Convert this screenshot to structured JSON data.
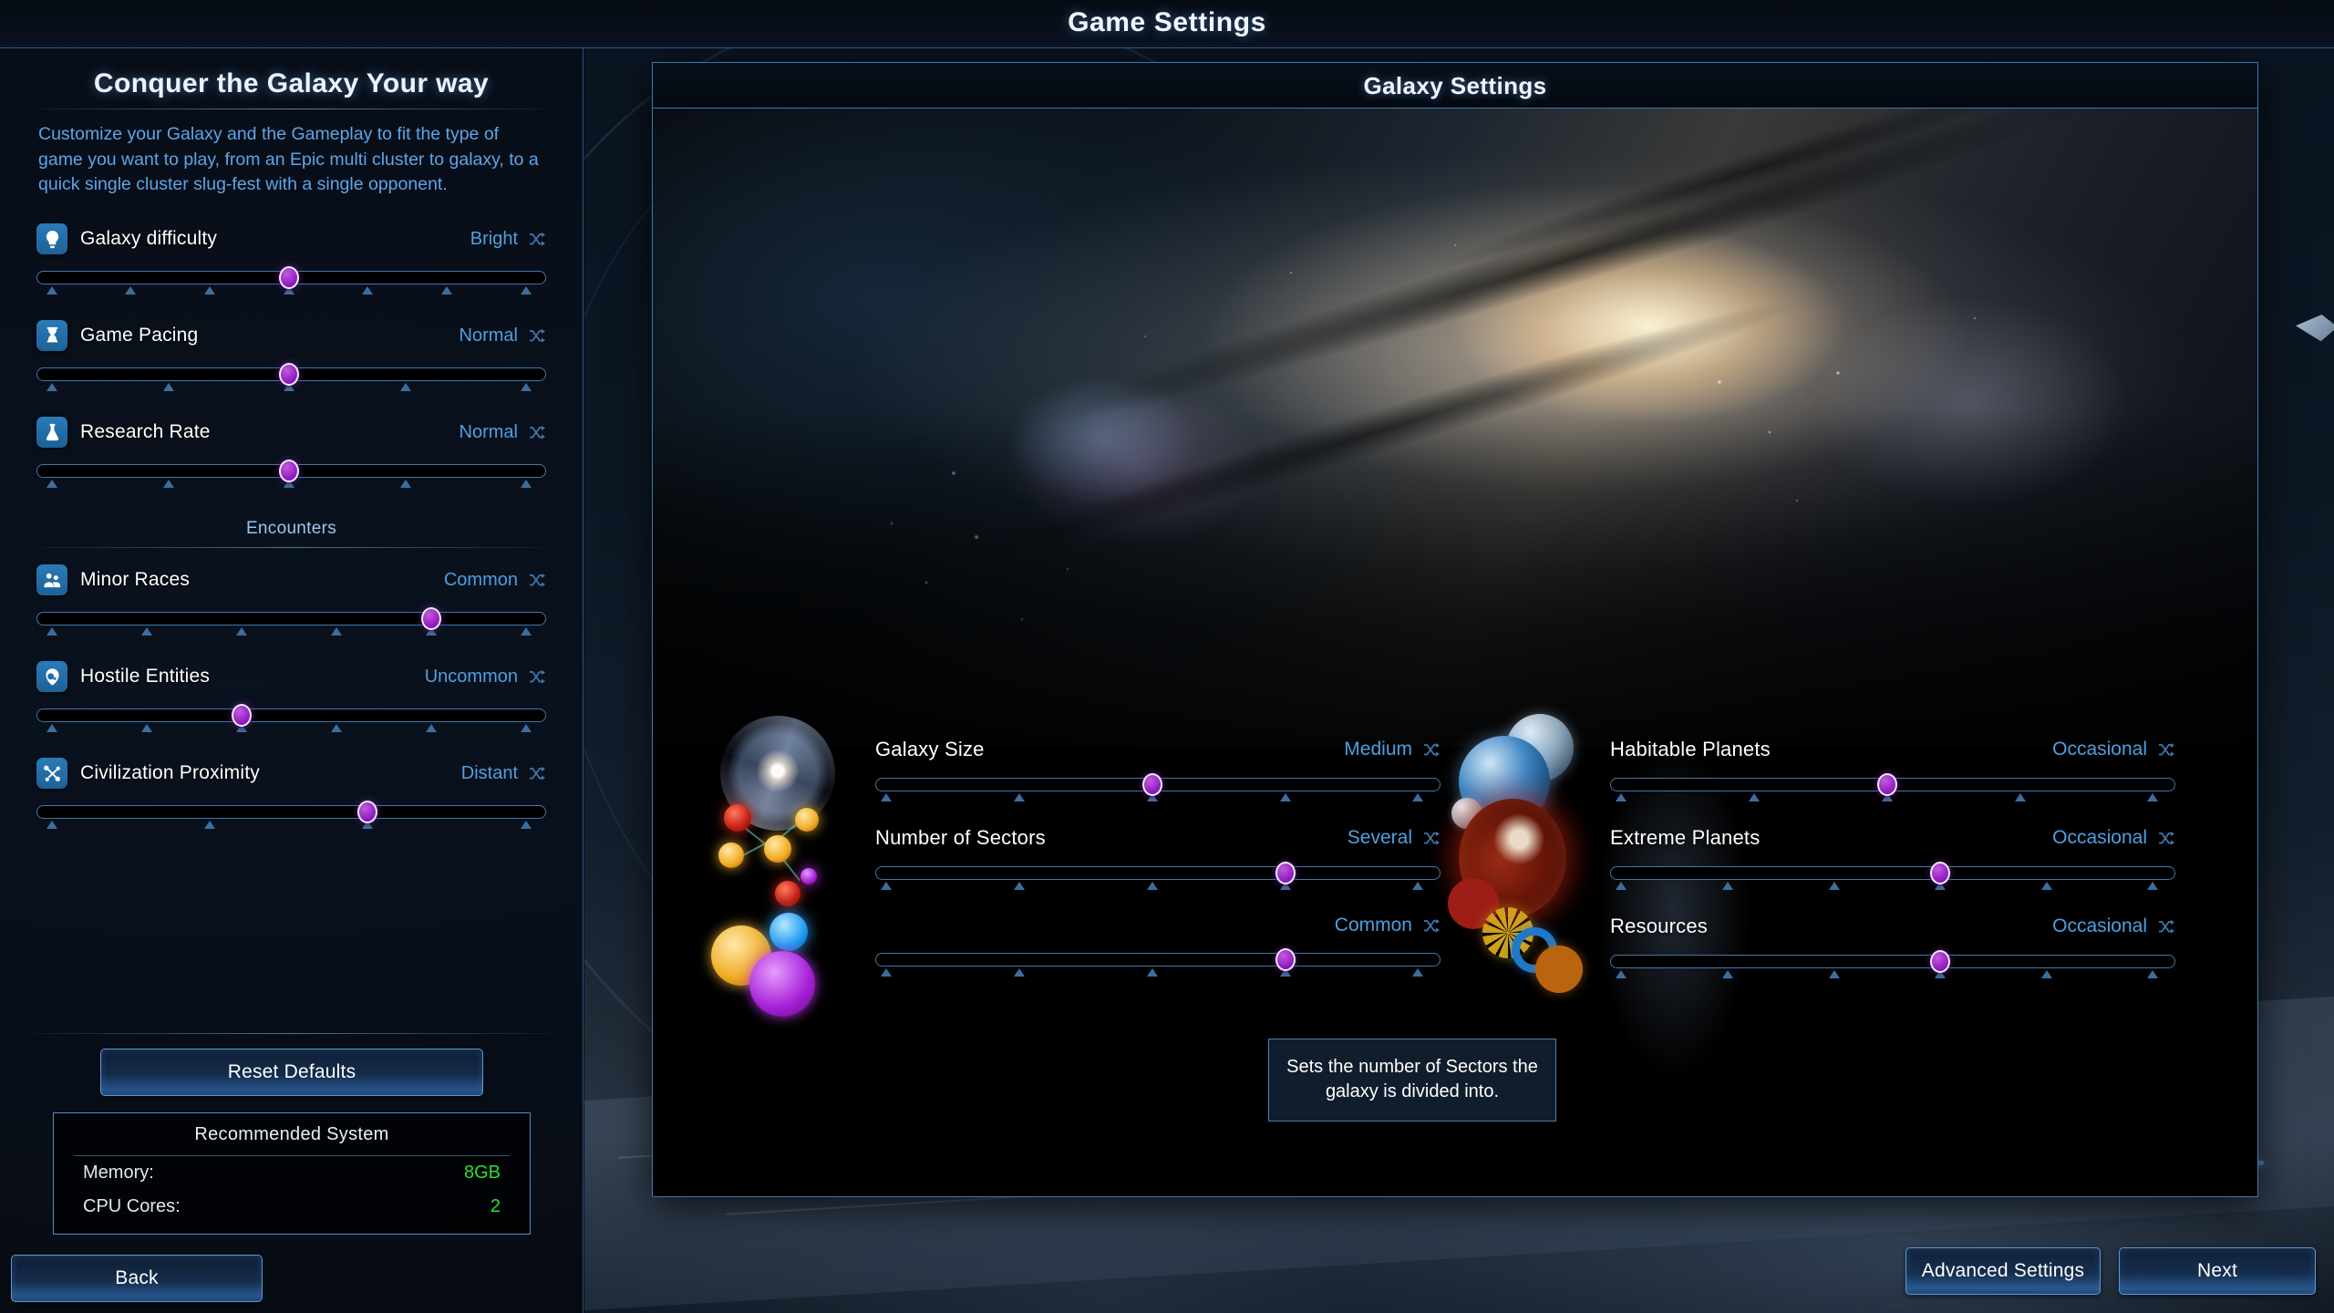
{
  "window": {
    "title": "Game Settings"
  },
  "sidebar": {
    "heading": "Conquer the Galaxy Your way",
    "description": "Customize your Galaxy and the Gameplay to fit the type of game you want to play, from an Epic multi cluster to galaxy, to a quick single cluster slug-fest with a single opponent.",
    "sliders": [
      {
        "label": "Galaxy difficulty",
        "value": "Bright",
        "icon": "lightbulb-icon",
        "ticks": 7,
        "position": 4
      },
      {
        "label": "Game Pacing",
        "value": "Normal",
        "icon": "hourglass-icon",
        "ticks": 5,
        "position": 3
      },
      {
        "label": "Research Rate",
        "value": "Normal",
        "icon": "flask-icon",
        "ticks": 5,
        "position": 3
      }
    ],
    "encounters_heading": "Encounters",
    "encounter_sliders": [
      {
        "label": "Minor Races",
        "value": "Common",
        "icon": "users-icon",
        "ticks": 6,
        "position": 5
      },
      {
        "label": "Hostile Entities",
        "value": "Uncommon",
        "icon": "alien-icon",
        "ticks": 6,
        "position": 3
      },
      {
        "label": "Civilization Proximity",
        "value": "Distant",
        "icon": "network-icon",
        "ticks": 4,
        "position": 3
      }
    ],
    "reset_label": "Reset Defaults",
    "recommended": {
      "title": "Recommended System",
      "rows": [
        {
          "key": "Memory:",
          "value": "8GB"
        },
        {
          "key": "CPU Cores:",
          "value": "2"
        }
      ]
    },
    "back_label": "Back"
  },
  "panel": {
    "title": "Galaxy Settings",
    "left_sliders": [
      {
        "label": "Galaxy Size",
        "value": "Medium",
        "thumb": "spiral-galaxy-thumb",
        "ticks": 5,
        "position": 3
      },
      {
        "label": "Number of Sectors",
        "value": "Several",
        "thumb": "star-cluster-thumb",
        "ticks": 5,
        "position": 4
      },
      {
        "label": "",
        "value": "Common",
        "thumb": "star-systems-thumb",
        "ticks": 5,
        "position": 4
      }
    ],
    "right_sliders": [
      {
        "label": "Habitable Planets",
        "value": "Occasional",
        "thumb": "habitable-planets-thumb",
        "ticks": 5,
        "position": 3
      },
      {
        "label": "Extreme Planets",
        "value": "Occasional",
        "thumb": "extreme-planet-thumb",
        "ticks": 6,
        "position": 4
      },
      {
        "label": "Resources",
        "value": "Occasional",
        "thumb": "resources-thumb",
        "ticks": 6,
        "position": 4
      }
    ]
  },
  "tooltip": {
    "text": "Sets the number of Sectors the galaxy is divided into."
  },
  "footer": {
    "advanced_label": "Advanced Settings",
    "next_label": "Next"
  },
  "colors": {
    "accent_blue": "#4f9fe0",
    "knob_purple": "#a41fd6",
    "good_green": "#2ee02e",
    "border_blue": "#3f77ac",
    "text_white": "#ffffff"
  }
}
